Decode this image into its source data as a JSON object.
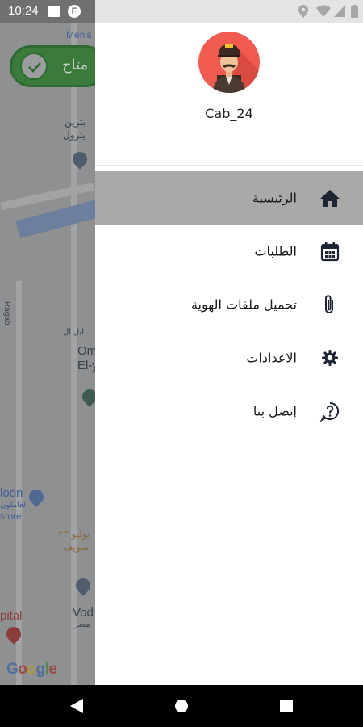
{
  "status_bar": {
    "time": "10:24",
    "f_icon": "F"
  },
  "map": {
    "labels": {
      "mens": "Men's",
      "brand1": "بترين",
      "brand2": "يترول",
      "ragab": "Ragab",
      "om1": "Om",
      "om2": "El-y",
      "near": "ابل ال",
      "loon": "loon",
      "store_ar": "العاملون",
      "store": "store",
      "july": "۲۳ يوليو",
      "suez": "سويف",
      "vod": "Vod",
      "vod_ar": "مصر",
      "pital": "pital"
    },
    "google_letters": [
      "G",
      "o",
      "o",
      "g",
      "l",
      "e"
    ]
  },
  "availability": {
    "label": "متاح"
  },
  "drawer": {
    "username": "Cab_24",
    "menu": [
      {
        "label": "الرئيسية",
        "icon": "home-icon",
        "active": true
      },
      {
        "label": "الطلبات",
        "icon": "calendar-icon",
        "active": false
      },
      {
        "label": "تحميل ملفات الهوية",
        "icon": "paperclip-icon",
        "active": false
      },
      {
        "label": "الاعدادات",
        "icon": "gear-icon",
        "active": false
      },
      {
        "label": "إتصل بنا",
        "icon": "help-circle-icon",
        "active": false
      }
    ]
  },
  "colors": {
    "accent_active": "#a9a9a9",
    "avatar_bg": "#f05a4f",
    "available_green": "#3a7b3c"
  }
}
